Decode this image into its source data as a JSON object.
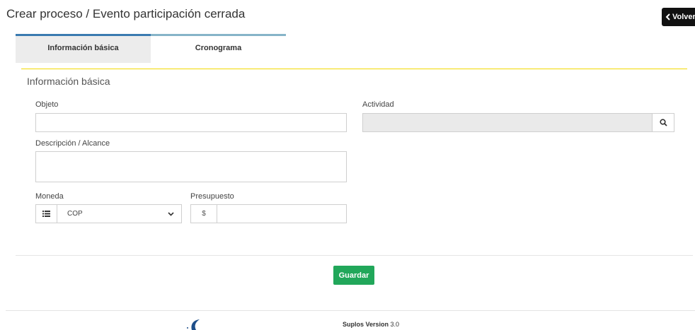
{
  "header": {
    "title": "Crear proceso / Evento participación cerrada",
    "back_label": "Volver"
  },
  "tabs": [
    {
      "label": "Información básica",
      "active": true
    },
    {
      "label": "Cronograma",
      "active": false
    }
  ],
  "form": {
    "section_title": "Información básica",
    "objeto": {
      "label": "Objeto",
      "value": ""
    },
    "actividad": {
      "label": "Actividad",
      "value": ""
    },
    "descripcion": {
      "label": "Descripción / Alcance",
      "value": ""
    },
    "moneda": {
      "label": "Moneda",
      "selected": "COP"
    },
    "presupuesto": {
      "label": "Presupuesto",
      "prefix": "$",
      "value": ""
    }
  },
  "actions": {
    "save_label": "Guardar"
  },
  "footer": {
    "version_label": "Suplos Version",
    "version_number": "3.0"
  },
  "colors": {
    "save": "#21a75a",
    "accent_line": "#f2d900",
    "tab_active": "#3a7ab0"
  }
}
